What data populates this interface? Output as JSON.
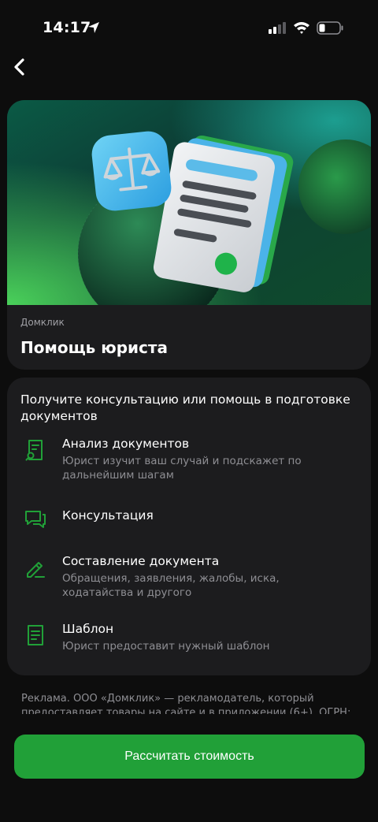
{
  "status_bar": {
    "time": "14:17"
  },
  "hero": {
    "brand": "Домклик",
    "title": "Помощь юриста"
  },
  "features": {
    "heading": "Получите консультацию или помощь в подготовке документов",
    "items": [
      {
        "icon": "document-search-icon",
        "title": "Анализ документов",
        "description": "Юрист изучит ваш случай и подскажет по дальнейшим шагам"
      },
      {
        "icon": "chat-bubbles-icon",
        "title": "Консультация",
        "description": ""
      },
      {
        "icon": "pencil-icon",
        "title": "Составление документа",
        "description": "Обращения, заявления, жалобы, иска, ходатайства и другого"
      },
      {
        "icon": "document-icon",
        "title": "Шаблон",
        "description": "Юрист предоставит нужный шаблон"
      }
    ]
  },
  "disclaimer": "Реклама. ООО «Домклик» — рекламодатель, который предоставляет товары на сайте и в приложении (6+). ОГРН:",
  "cta": {
    "label": "Рассчитать стоимость"
  },
  "colors": {
    "accent": "#21a038",
    "card": "#1c1c1e",
    "background": "#0d0d0d",
    "secondary_text": "#8e8e93"
  }
}
